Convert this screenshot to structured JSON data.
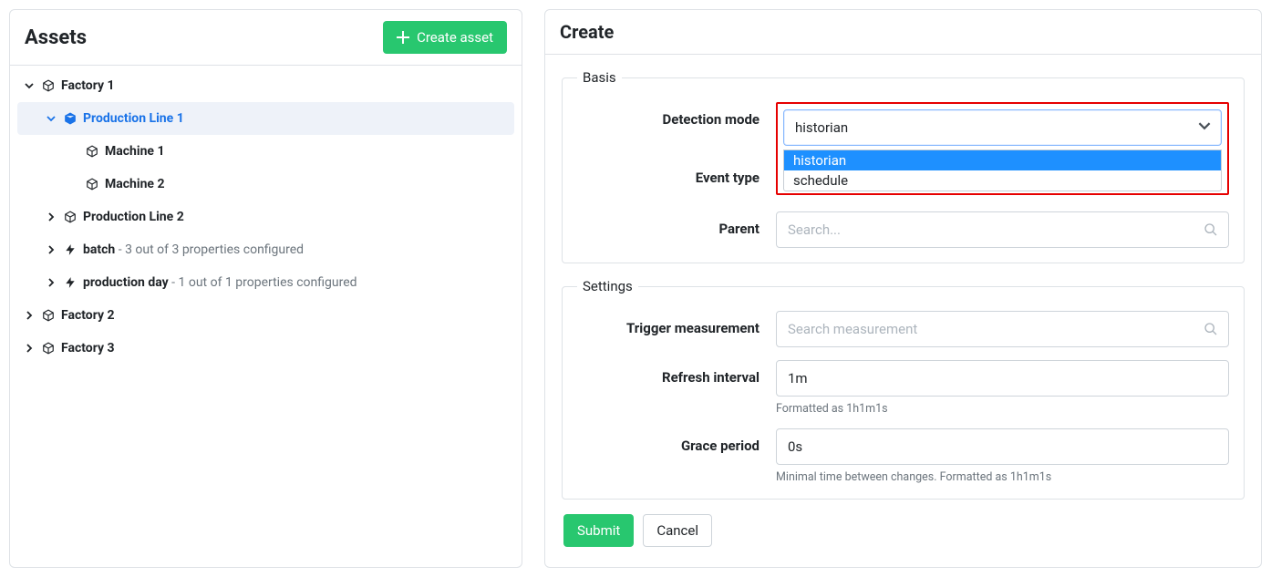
{
  "left": {
    "title": "Assets",
    "create_button": "Create asset",
    "tree": {
      "factory1": {
        "label": "Factory 1"
      },
      "line1": {
        "label": "Production Line 1"
      },
      "machine1": {
        "label": "Machine 1"
      },
      "machine2": {
        "label": "Machine 2"
      },
      "line2": {
        "label": "Production Line 2"
      },
      "batch": {
        "label": "batch",
        "suffix": " - 3 out of 3 properties configured"
      },
      "prodday": {
        "label": "production day",
        "suffix": " - 1 out of 1 properties configured"
      },
      "factory2": {
        "label": "Factory 2"
      },
      "factory3": {
        "label": "Factory 3"
      }
    }
  },
  "right": {
    "title": "Create",
    "basis": {
      "legend": "Basis",
      "detection_mode": {
        "label": "Detection mode",
        "value": "historian",
        "options": [
          "historian",
          "schedule"
        ]
      },
      "event_type": {
        "label": "Event type"
      },
      "parent": {
        "label": "Parent",
        "placeholder": "Search..."
      }
    },
    "settings": {
      "legend": "Settings",
      "trigger": {
        "label": "Trigger measurement",
        "placeholder": "Search measurement"
      },
      "refresh": {
        "label": "Refresh interval",
        "value": "1m",
        "help": "Formatted as 1h1m1s"
      },
      "grace": {
        "label": "Grace period",
        "value": "0s",
        "help": "Minimal time between changes. Formatted as 1h1m1s"
      }
    },
    "actions": {
      "submit": "Submit",
      "cancel": "Cancel"
    }
  }
}
